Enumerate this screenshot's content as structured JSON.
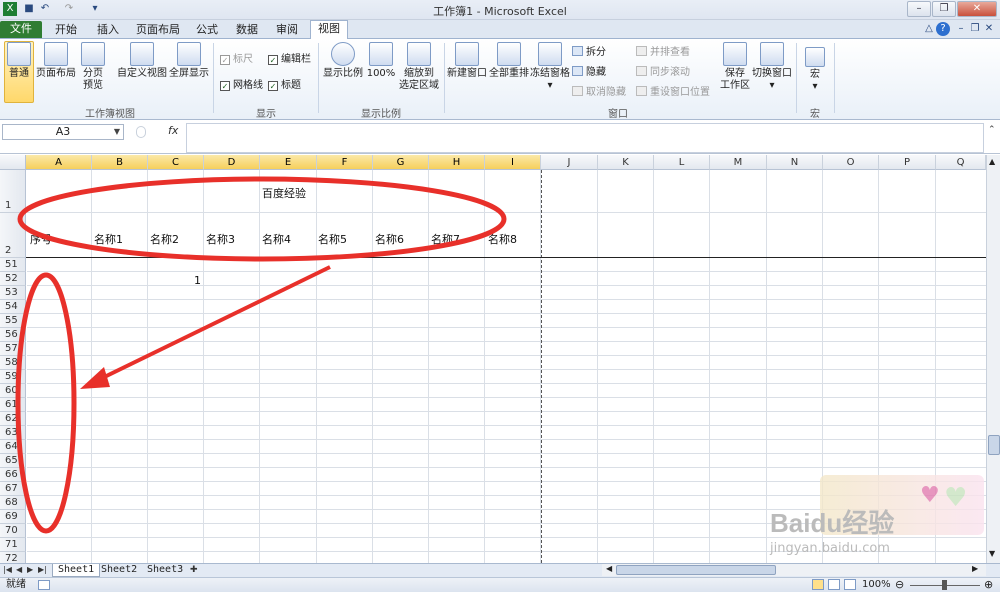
{
  "window": {
    "title": "工作簿1 - Microsoft Excel",
    "quick_access": [
      "save-icon",
      "undo-icon",
      "redo-icon"
    ],
    "controls": [
      "minimize",
      "restore",
      "close"
    ]
  },
  "tabs": [
    {
      "label": "文件",
      "file": true
    },
    {
      "label": "开始"
    },
    {
      "label": "插入"
    },
    {
      "label": "页面布局"
    },
    {
      "label": "公式"
    },
    {
      "label": "数据"
    },
    {
      "label": "审阅"
    },
    {
      "label": "视图",
      "active": true
    }
  ],
  "ribbon": {
    "group_workbook_views": {
      "label": "工作簿视图",
      "normal": "普通",
      "page_layout": "页面布局",
      "page_break_line1": "分页",
      "page_break_line2": "预览",
      "custom_view": "自定义视图",
      "full_screen": "全屏显示"
    },
    "group_show": {
      "label": "显示",
      "ruler": "标尺",
      "formula_bar": "编辑栏",
      "gridlines": "网格线",
      "headings": "标题"
    },
    "group_zoom": {
      "label": "显示比例",
      "zoom": "显示比例",
      "zoom100": "100%",
      "zoom_sel_line1": "缩放到",
      "zoom_sel_line2": "选定区域"
    },
    "group_window": {
      "label": "窗口",
      "new_window": "新建窗口",
      "arrange_all": "全部重排",
      "freeze": "冻结窗格",
      "split": "拆分",
      "hide": "隐藏",
      "unhide": "取消隐藏",
      "side_by_side": "并排查看",
      "sync_scroll": "同步滚动",
      "reset_pos": "重设窗口位置",
      "save_ws_line1": "保存",
      "save_ws_line2": "工作区",
      "switch": "切换窗口"
    },
    "group_macros": {
      "label": "宏",
      "macros": "宏"
    }
  },
  "formula_bar": {
    "name_box": "A3",
    "fx": "fx",
    "value": ""
  },
  "grid": {
    "columns": [
      "A",
      "B",
      "C",
      "D",
      "E",
      "F",
      "G",
      "H",
      "I",
      "J",
      "K",
      "L",
      "M",
      "N",
      "O",
      "P",
      "Q"
    ],
    "rows": [
      "1",
      "2",
      "51",
      "52",
      "53",
      "54",
      "55",
      "56",
      "57",
      "58",
      "59",
      "60",
      "61",
      "62",
      "63",
      "64",
      "65",
      "66",
      "67",
      "68",
      "69",
      "70",
      "71",
      "72"
    ],
    "cells": {
      "title": "百度经验",
      "seq": "序号",
      "names": [
        "名称1",
        "名称2",
        "名称3",
        "名称4",
        "名称5",
        "名称6",
        "名称7",
        "名称8"
      ],
      "c52": "1"
    }
  },
  "sheets": [
    {
      "label": "Sheet1",
      "active": true
    },
    {
      "label": "Sheet2"
    },
    {
      "label": "Sheet3"
    }
  ],
  "status": {
    "ready": "就绪",
    "zoom": "100%"
  },
  "watermark": {
    "brand": "Baidu经验",
    "url": "jingyan.baidu.com"
  },
  "colors": {
    "annotation": "#e8302a",
    "file_tab": "#2f7d32",
    "selected": "#ffd86b"
  }
}
